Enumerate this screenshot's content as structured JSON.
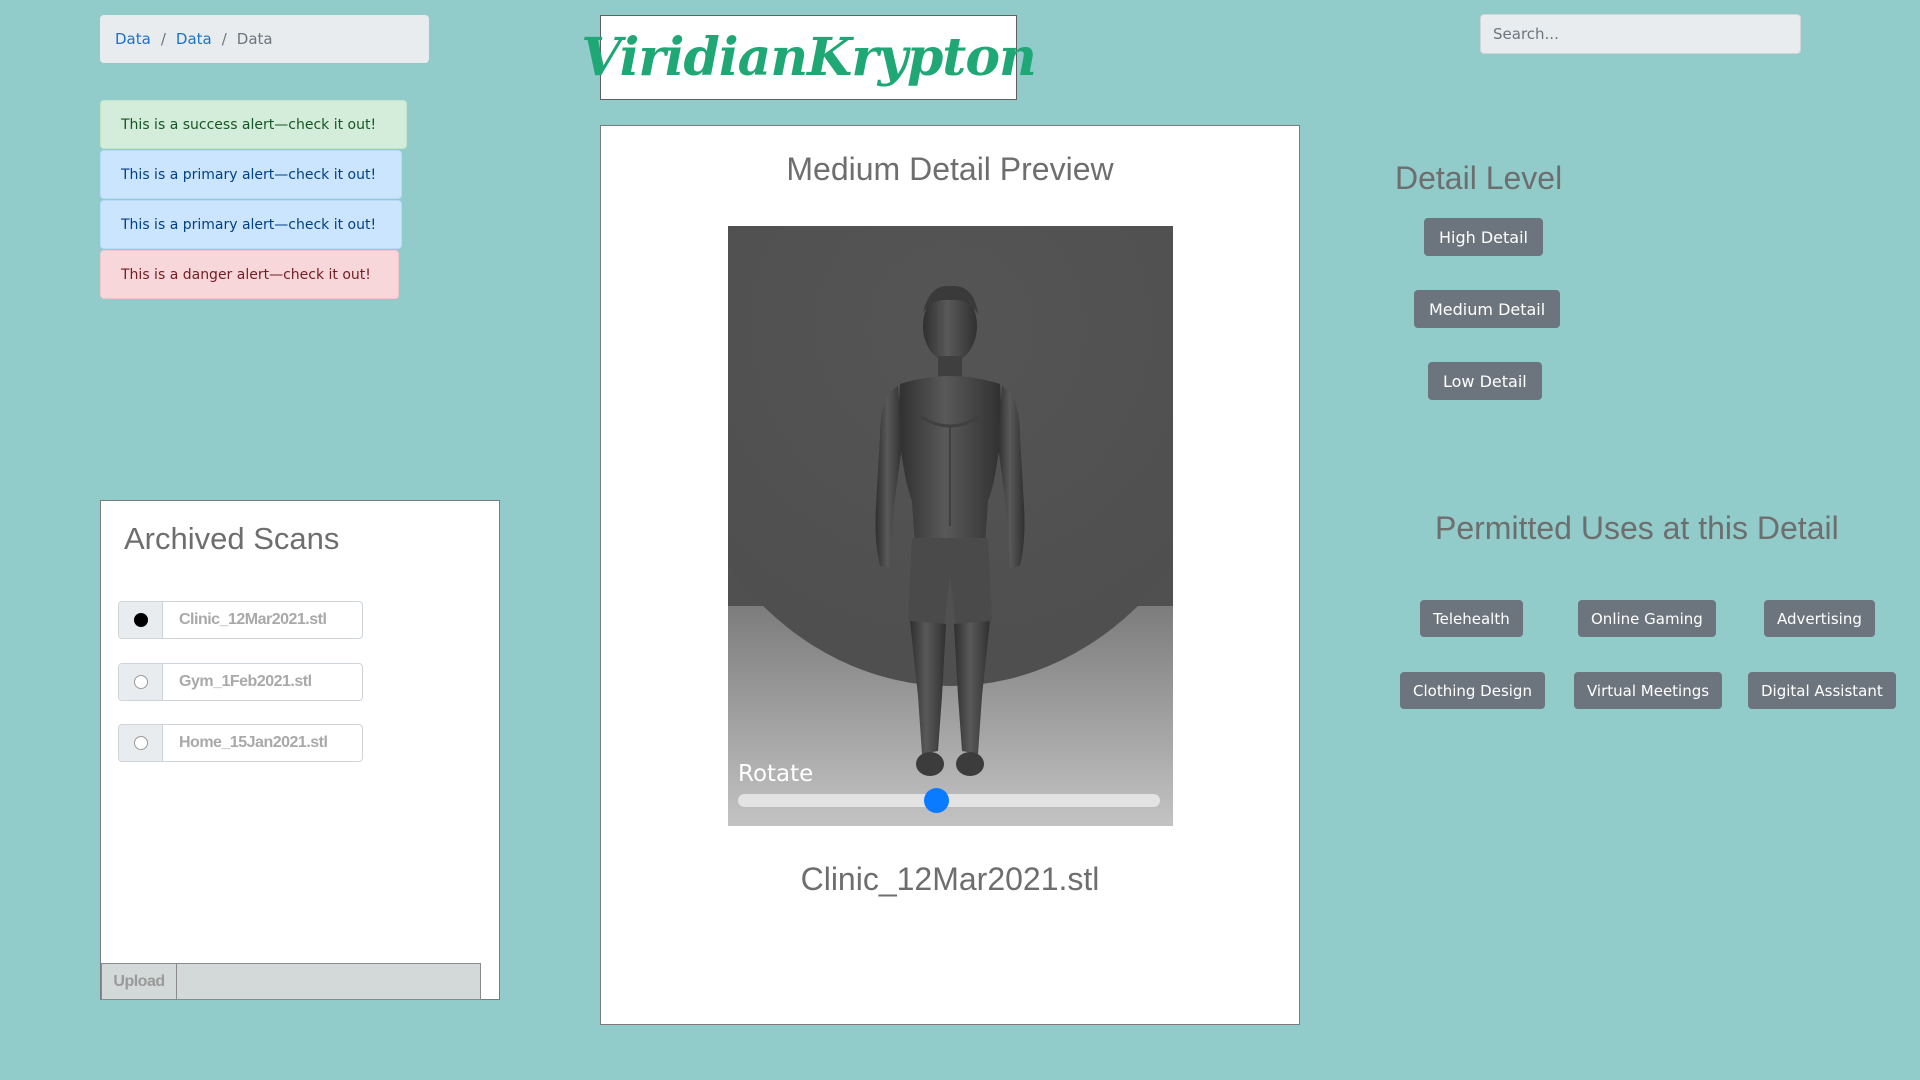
{
  "breadcrumb": {
    "items": [
      "Data",
      "Data",
      "Data"
    ]
  },
  "alerts": [
    {
      "type": "success",
      "text": "This is a success alert—check it out!"
    },
    {
      "type": "primary",
      "text": "This is a primary alert—check it out!"
    },
    {
      "type": "primary",
      "text": "This is a primary alert—check it out!"
    },
    {
      "type": "danger",
      "text": "This is a danger alert—check it out!"
    }
  ],
  "logo": {
    "text": "ViridianKrypton",
    "color": "#1fa776"
  },
  "search": {
    "placeholder": "Search..."
  },
  "archive": {
    "title": "Archived Scans",
    "scans": [
      {
        "name": "Clinic_12Mar2021.stl",
        "selected": true
      },
      {
        "name": "Gym_1Feb2021.stl",
        "selected": false
      },
      {
        "name": "Home_15Jan2021.stl",
        "selected": false
      }
    ],
    "upload_label": "Upload"
  },
  "preview": {
    "title": "Medium Detail Preview",
    "rotate_label": "Rotate",
    "rotate_value": 0.47,
    "filename": "Clinic_12Mar2021.stl"
  },
  "detail_level": {
    "title": "Detail Level",
    "buttons": [
      "High Detail",
      "Medium Detail",
      "Low Detail"
    ]
  },
  "permitted_uses": {
    "title": "Permitted Uses at this Detail",
    "uses": [
      "Telehealth",
      "Online Gaming",
      "Advertising",
      "Clothing Design",
      "Virtual Meetings",
      "Digital Assistant"
    ]
  },
  "colors": {
    "background": "#91cbca",
    "button": "#6c757d",
    "slider_thumb": "#0a7bff"
  }
}
